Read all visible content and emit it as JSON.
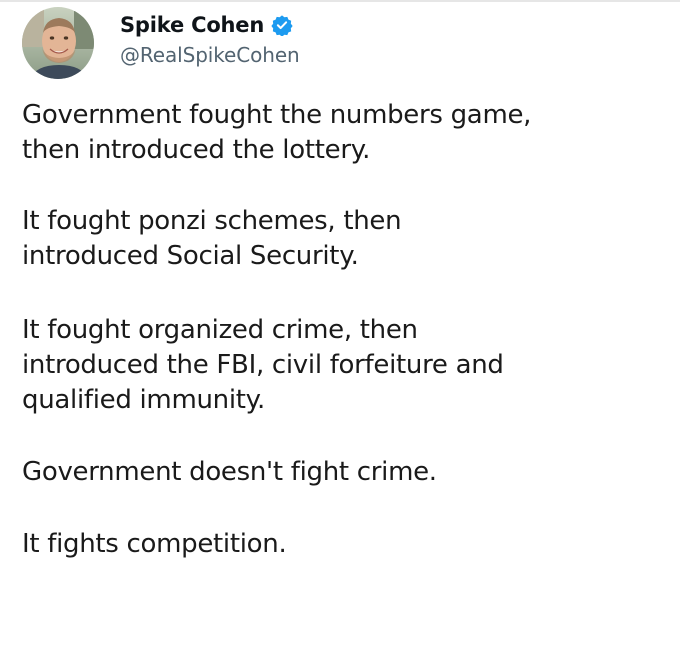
{
  "author": {
    "display_name": "Spike Cohen",
    "handle": "@RealSpikeCohen",
    "verified": true,
    "verified_icon": "verified-badge-icon",
    "verified_color": "#1d9bf0",
    "avatar": "profile-photo"
  },
  "tweet": {
    "paragraphs": [
      {
        "lines": [
          "Government fought the numbers game,",
          "then introduced the lottery."
        ]
      },
      {
        "lines": [
          "It fought ponzi schemes, then",
          "introduced Social Security."
        ]
      },
      {
        "lines": [
          "It fought organized crime, then",
          "introduced the FBI, civil forfeiture and",
          "qualified immunity."
        ]
      },
      {
        "lines": [
          "Government doesn't fight crime."
        ]
      },
      {
        "lines": [
          "It fights competition."
        ]
      }
    ]
  },
  "colors": {
    "text": "#0f1419",
    "handle": "#536471",
    "background": "#ffffff"
  }
}
